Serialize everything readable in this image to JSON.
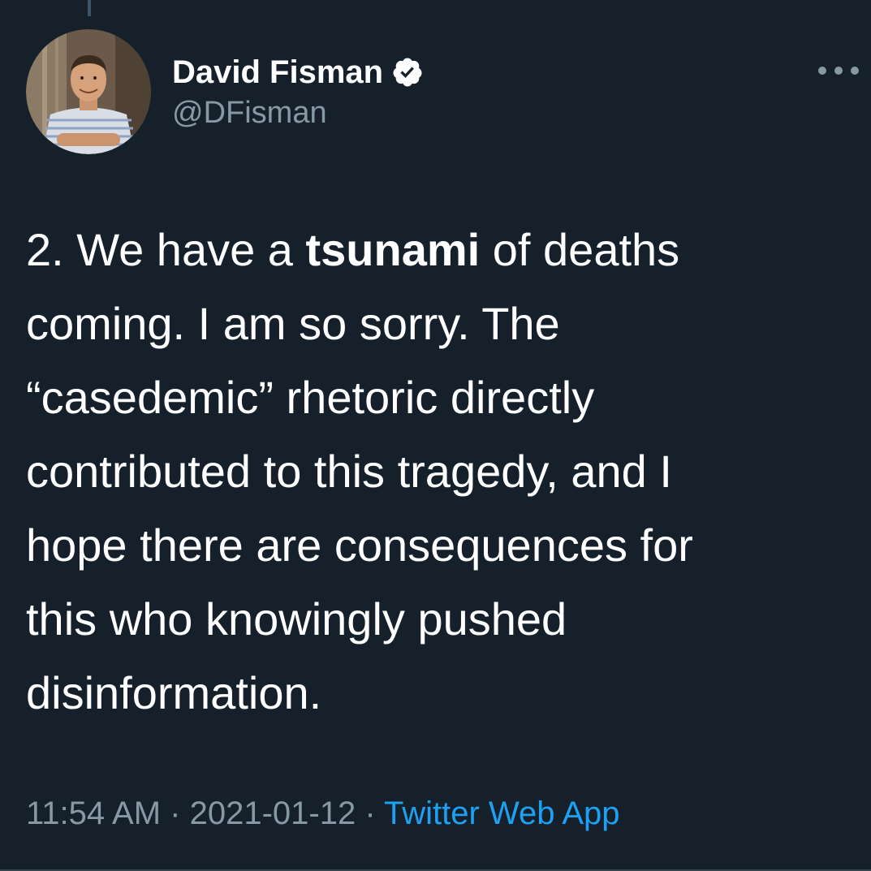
{
  "author": {
    "display_name": "David Fisman",
    "handle": "@DFisman",
    "verified": true
  },
  "tweet": {
    "lines": [
      [
        "2. We have a ",
        "tsunami",
        " of deaths"
      ],
      "coming.  I am so sorry.  The",
      "“casedemic” rhetoric directly",
      "contributed to this tragedy, and I",
      "hope there are consequences for",
      "this who knowingly pushed",
      "disinformation."
    ]
  },
  "meta": {
    "time": "11:54 AM",
    "separator": " · ",
    "date": "2021-01-12",
    "source": "Twitter Web App"
  },
  "icons": {
    "verified": "verified-badge-icon",
    "more": "more-options-icon"
  },
  "colors": {
    "background": "#15202b",
    "secondary_text": "#8899a6",
    "link": "#1da1f2"
  }
}
